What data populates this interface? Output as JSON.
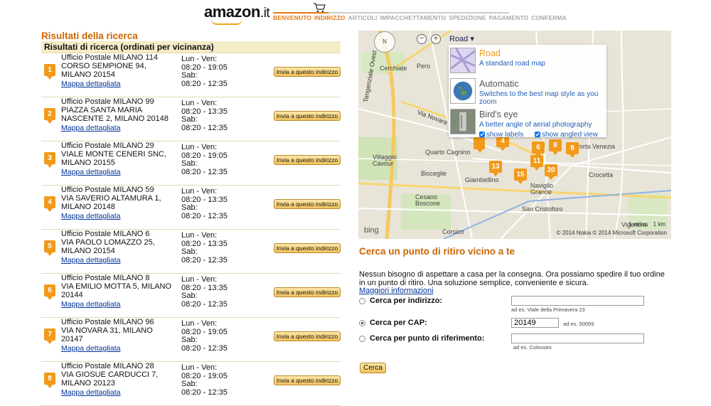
{
  "header": {
    "logo_text": "amazon",
    "logo_suffix": ".it",
    "steps": [
      "BENVENUTO",
      "INDIRIZZO",
      "ARTICOLI",
      "IMPACCHETTAMENTO",
      "SPEDIZIONE",
      "PAGAMENTO",
      "CONFERMA"
    ],
    "completed_step_count": 1,
    "current_step": "INDIRIZZO"
  },
  "results": {
    "title": "Risultati della ricerca",
    "subtitle": "Risultati di ricerca (ordinati per vicinanza)",
    "map_link_label": "Mappa dettagliata",
    "send_button_label": "Invia a questo indirizzo",
    "items": [
      {
        "number": "1",
        "name": "Ufficio Postale MILANO 114",
        "address": "CORSO SEMPIONE 94, MILANO 20154",
        "hours": [
          "Lun - Ven:",
          "08:20 - 19:05",
          "Sab:",
          "08:20 - 12:35"
        ]
      },
      {
        "number": "2",
        "name": "Ufficio Postale MILANO 99",
        "address": "PIAZZA SANTA MARIA NASCENTE 2, MILANO 20148",
        "hours": [
          "Lun - Ven:",
          "08:20 - 13:35",
          "Sab:",
          "08:20 - 12:35"
        ]
      },
      {
        "number": "3",
        "name": "Ufficio Postale MILANO 29",
        "address": "VIALE MONTE CENERI SNC, MILANO 20155",
        "hours": [
          "Lun - Ven:",
          "08:20 - 19:05",
          "Sab:",
          "08:20 - 12:35"
        ]
      },
      {
        "number": "4",
        "name": "Ufficio Postale MILANO 59",
        "address": "VIA SAVERIO ALTAMURA 1, MILANO 20148",
        "hours": [
          "Lun - Ven:",
          "08:20 - 13:35",
          "Sab:",
          "08:20 - 12:35"
        ]
      },
      {
        "number": "5",
        "name": "Ufficio Postale MILANO 6",
        "address": "VIA PAOLO LOMAZZO 25, MILANO 20154",
        "hours": [
          "Lun - Ven:",
          "08:20 - 13:35",
          "Sab:",
          "08:20 - 12:35"
        ]
      },
      {
        "number": "6",
        "name": "Ufficio Postale MILANO 8",
        "address": "VIA EMILIO MOTTA 5, MILANO 20144",
        "hours": [
          "Lun - Ven:",
          "08:20 - 13:35",
          "Sab:",
          "08:20 - 12:35"
        ]
      },
      {
        "number": "7",
        "name": "Ufficio Postale MILANO 96",
        "address": "VIA NOVARA 31, MILANO 20147",
        "hours": [
          "Lun - Ven:",
          "08:20 - 19:05",
          "Sab:",
          "08:20 - 12:35"
        ]
      },
      {
        "number": "8",
        "name": "Ufficio Postale MILANO 28",
        "address": "VIA GIOSUE CARDUCCI 7, MILANO 20123",
        "hours": [
          "Lun - Ven:",
          "08:20 - 19:05",
          "Sab:",
          "08:20 - 12:35"
        ]
      }
    ]
  },
  "map": {
    "compass_label": "N",
    "zoom_out": "−",
    "zoom_in": "+",
    "style_dropdown": "Road ▾",
    "styles": [
      {
        "name": "Road",
        "desc": "A standard road map"
      },
      {
        "name": "Automatic",
        "desc": "Switches to the best map style as you zoom"
      },
      {
        "name": "Bird's eye",
        "desc": "A better angle of aerial photography"
      }
    ],
    "show_labels": "show labels",
    "show_angled": "show angled view",
    "places": [
      "Cerchiate",
      "Pero",
      "Quarto Cagnino",
      "Villaggio Cavour",
      "Cesano Boscone",
      "Corsico",
      "San Cristoforo",
      "Naviglio Grande",
      "Crocetta",
      "Porta Venezia",
      "Via Novara",
      "Tangenziale Ovest",
      "Vigentino",
      "Bisceglie",
      "Giambellino"
    ],
    "markers": [
      "4",
      "6",
      "8",
      "8",
      "11",
      "13",
      "15",
      "20"
    ],
    "bing_label": "bing",
    "scale_miles": "1 miles",
    "scale_km": "1 km",
    "copyright": "© 2014 Nokia  © 2014 Microsoft Corporation"
  },
  "search": {
    "title": "Cerca un punto di ritiro vicino a te",
    "description": "Nessun bisogno di aspettare a casa per la consegna. Ora possiamo spedire il tuo ordine in un punto di ritiro. Una soluzione semplice, conveniente e sicura.",
    "more_info_link": "Maggiori informazioni",
    "by_address_label": "Cerca per indirizzo:",
    "by_address_value": "",
    "by_address_hint": "ad es. Viale della Primavera 23",
    "by_cap_label": "Cerca per CAP:",
    "by_cap_value": "20149",
    "by_cap_hint": "ad es. 50059",
    "by_landmark_label": "Cerca per punto di riferimento:",
    "by_landmark_value": "",
    "by_landmark_hint": "ad es. Colosseo",
    "search_button": "Cerca",
    "selected_option": "Cerca per CAP:"
  }
}
